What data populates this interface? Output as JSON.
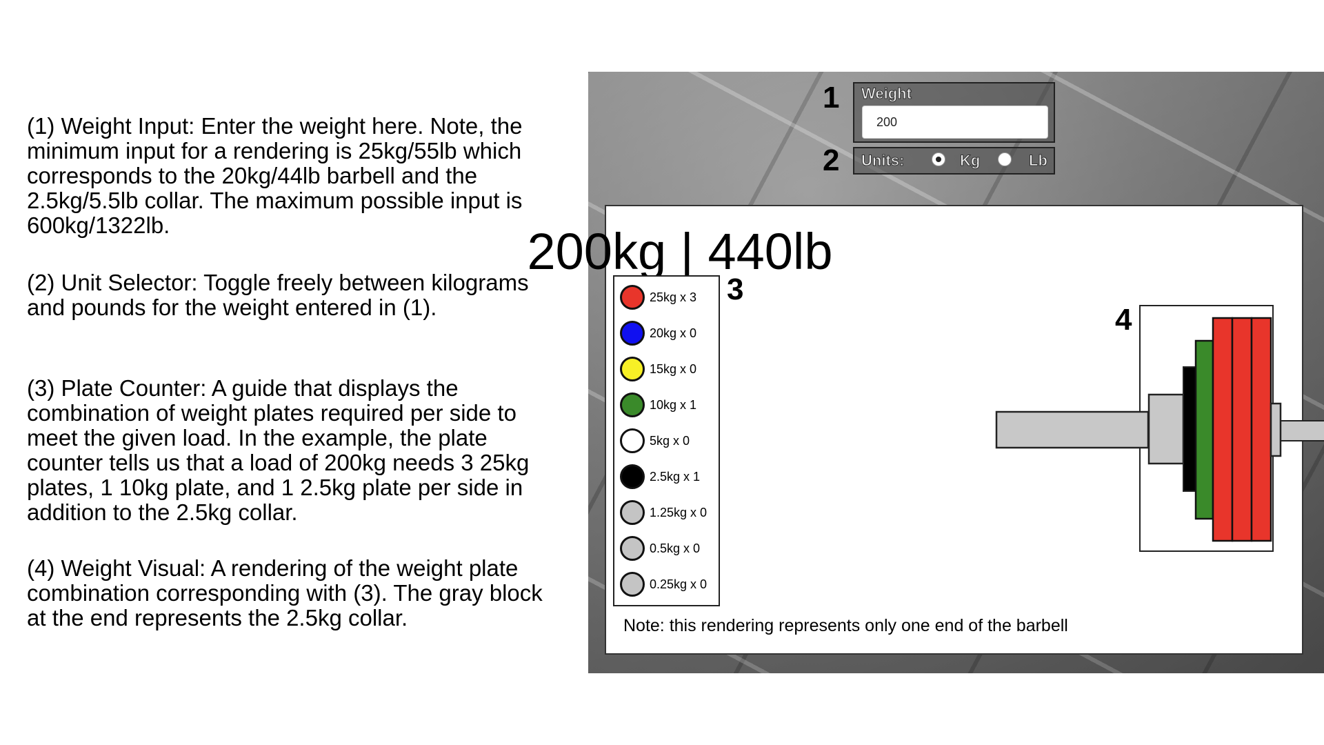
{
  "descriptions": [
    "(1) Weight Input: Enter the weight here.  Note, the minimum input for a rendering is 25kg/55lb which corresponds to the 20kg/44lb barbell and the 2.5kg/5.5lb collar.  The maximum possible input is 600kg/1322lb.",
    "(2) Unit Selector: Toggle freely between kilograms and pounds for the weight entered in (1).",
    "(3) Plate Counter: A guide that displays the combination of weight plates required per side to meet the given load.  In the example, the plate counter tells us that a load of 200kg needs 3 25kg plates, 1 10kg plate, and 1 2.5kg plate per side in addition to the 2.5kg collar.",
    "(4) Weight Visual: A rendering of the weight plate combination corresponding with (3).  The gray block at the end represents the 2.5kg collar."
  ],
  "callouts": [
    "1",
    "2",
    "3",
    "4"
  ],
  "weight_input": {
    "label": "Weight",
    "value": "200"
  },
  "units": {
    "label": "Units:",
    "options": [
      "Kg",
      "Lb"
    ],
    "selected": "Kg"
  },
  "display": {
    "title": "200kg | 440lb"
  },
  "plate_counter": [
    {
      "label": "25kg x 3",
      "color": "#e8352b"
    },
    {
      "label": "20kg x 0",
      "color": "#1010f0"
    },
    {
      "label": "15kg x 0",
      "color": "#f7f026"
    },
    {
      "label": "10kg x 1",
      "color": "#3a8a2a"
    },
    {
      "label": "5kg x 0",
      "color": "#ffffff"
    },
    {
      "label": "2.5kg x 1",
      "color": "#000000"
    },
    {
      "label": "1.25kg x 0",
      "color": "#c4c4c4"
    },
    {
      "label": "0.5kg x 0",
      "color": "#c4c4c4"
    },
    {
      "label": "0.25kg x 0",
      "color": "#c4c4c4"
    }
  ],
  "note": "Note: this rendering represents only one end of the barbell"
}
